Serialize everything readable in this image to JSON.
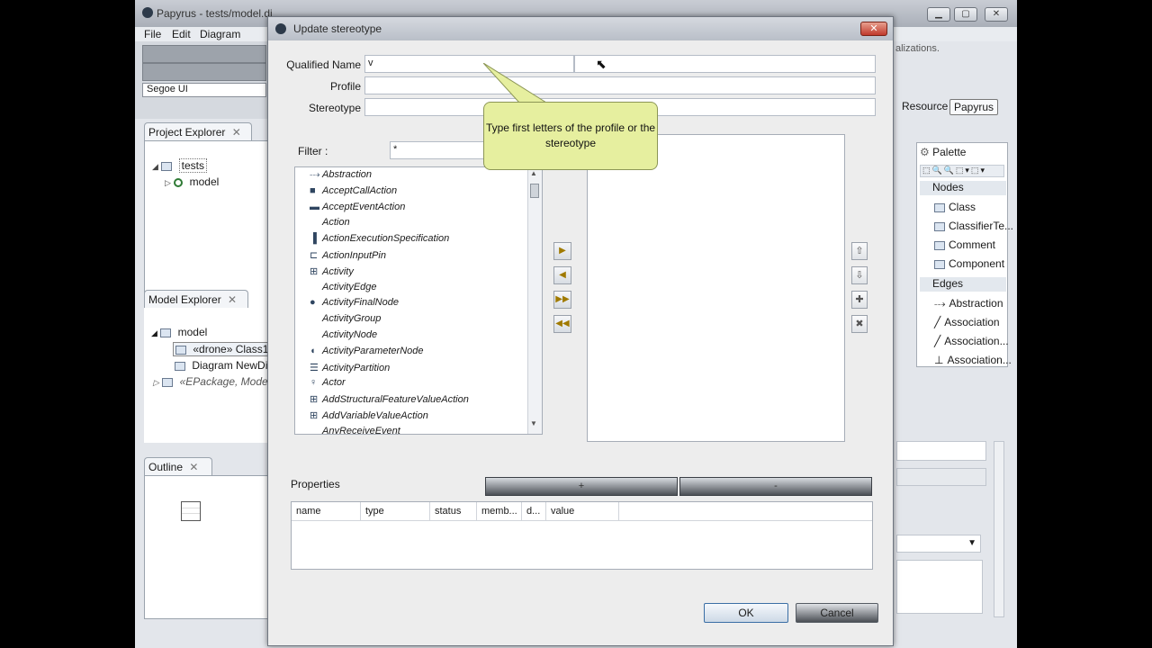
{
  "app": {
    "title": "Papyrus - tests/model.di",
    "menu": [
      "File",
      "Edit",
      "Diagram"
    ],
    "font_combo": "Segoe UI"
  },
  "project_explorer": {
    "tab": "Project Explorer",
    "root": "tests",
    "child": "model"
  },
  "model_explorer": {
    "tab": "Model Explorer",
    "root": "model",
    "items": [
      "«drone» Class1",
      "Diagram NewDia",
      "«EPackage, ModelLi"
    ]
  },
  "outline": {
    "tab": "Outline"
  },
  "perspectives": {
    "resource": "Resource",
    "papyrus": "Papyrus"
  },
  "palette": {
    "title": "Palette",
    "nodes_drawer": "Nodes",
    "nodes": [
      "Class",
      "ClassifierTe...",
      "Comment",
      "Component"
    ],
    "edges_drawer": "Edges",
    "edges": [
      "Abstraction",
      "Association",
      "Association...",
      "Association..."
    ]
  },
  "background_text": {
    "top_right": "alizations."
  },
  "dialog": {
    "title": "Update stereotype",
    "close": "✕",
    "qualified_name_label": "Qualified Name",
    "qualified_name_value": "v",
    "profile_label": "Profile",
    "profile_value": "",
    "stereotype_label": "Stereotype",
    "stereotype_value": "",
    "filter_label": "Filter :",
    "filter_value": "*",
    "list": [
      "Abstraction",
      "AcceptCallAction",
      "AcceptEventAction",
      "Action",
      "ActionExecutionSpecification",
      "ActionInputPin",
      "Activity",
      "ActivityEdge",
      "ActivityFinalNode",
      "ActivityGroup",
      "ActivityNode",
      "ActivityParameterNode",
      "ActivityPartition",
      "Actor",
      "AddStructuralFeatureValueAction",
      "AddVariableValueAction",
      "AnyReceiveEvent"
    ],
    "properties_label": "Properties",
    "add_label": "+",
    "remove_label": "-",
    "columns": [
      "name",
      "type",
      "status",
      "memb...",
      "d...",
      "value"
    ],
    "ok_label": "OK",
    "cancel_label": "Cancel",
    "tooltip": "Type first letters of the profile or the stereotype"
  }
}
